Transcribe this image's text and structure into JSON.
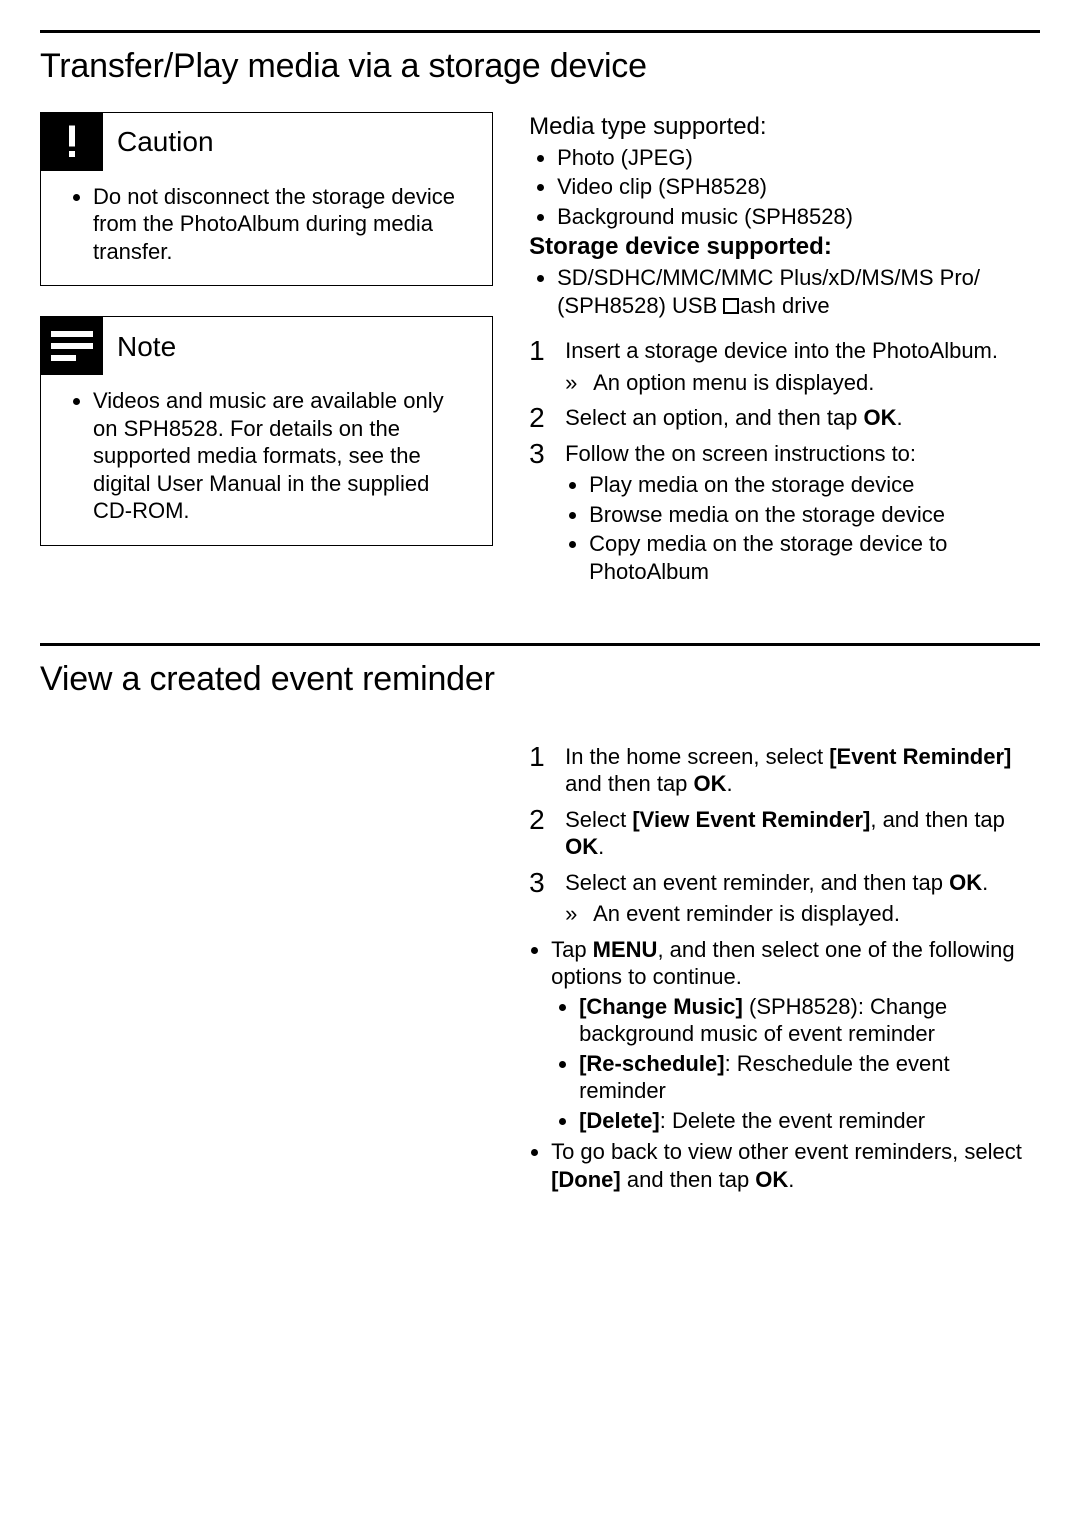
{
  "section1": {
    "title": "Transfer/Play media via a storage device",
    "caution": {
      "heading": "Caution",
      "item": "Do not disconnect the storage device from the PhotoAlbum during media transfer."
    },
    "note": {
      "heading": "Note",
      "item": "Videos and music are available only on SPH8528. For details on the supported media formats, see the digital User Manual in the supplied CD-ROM."
    },
    "media_type_heading": "Media type supported:",
    "media_types": [
      "Photo (JPEG)",
      "Video clip (SPH8528)",
      "Background music (SPH8528)"
    ],
    "storage_heading": "Storage device supported:",
    "storage_item_prefix": "SD/SDHC/MMC/MMC Plus/xD/MS/MS Pro/ (SPH8528) USB ",
    "storage_item_suffix": "ash drive",
    "steps": {
      "s1": "Insert a storage device into the PhotoAlbum.",
      "s1_result": "An option menu is displayed.",
      "s2_a": "Select an option, and then tap ",
      "s2_b": "OK",
      "s2_c": ".",
      "s3": "Follow the on screen instructions to:",
      "s3_bullets": [
        "Play media on the storage device",
        "Browse media on the storage device",
        "Copy media on the storage device to PhotoAlbum"
      ]
    }
  },
  "section2": {
    "title": "View a created event reminder",
    "steps": {
      "s1_a": "In the home screen, select ",
      "s1_b": "[Event Reminder]",
      "s1_c": " and then tap ",
      "s1_d": "OK",
      "s1_e": ".",
      "s2_a": "Select ",
      "s2_b": "[View Event Reminder]",
      "s2_c": ", and then tap ",
      "s2_d": "OK",
      "s2_e": ".",
      "s3_a": "Select an event reminder, and then tap ",
      "s3_b": "OK",
      "s3_c": ".",
      "s3_result": "An event reminder is displayed."
    },
    "bullets": {
      "b1_a": "Tap ",
      "b1_b": "MENU",
      "b1_c": ", and then select one of the following options to continue.",
      "b1_sub": {
        "i1_a": "[Change Music]",
        "i1_b": " (SPH8528): Change background music of event reminder",
        "i2_a": "[Re-schedule]",
        "i2_b": ": Reschedule the event reminder",
        "i3_a": "[Delete]",
        "i3_b": ": Delete the event reminder"
      },
      "b2_a": "To go back to view other event reminders, select ",
      "b2_b": "[Done]",
      "b2_c": " and then tap ",
      "b2_d": "OK",
      "b2_e": "."
    }
  }
}
